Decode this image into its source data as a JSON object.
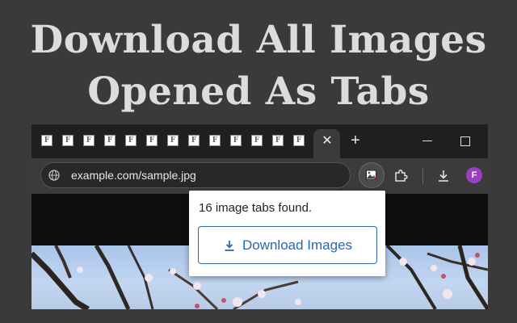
{
  "headline": {
    "line1": "Download All Images",
    "line2": "Opened As Tabs"
  },
  "browser": {
    "tab_favicon_letter": "F",
    "tab_count_visible": 13,
    "address": "example.com/sample.jpg",
    "avatar_letter": "F",
    "icons": [
      "globe-icon",
      "extension-image-icon",
      "puzzle-icon",
      "download-icon",
      "close-icon",
      "plus-icon",
      "minimize-icon",
      "maximize-icon"
    ]
  },
  "popup": {
    "status_text": "16 image tabs found.",
    "button_label": "Download Images"
  },
  "colors": {
    "accent": "#2f66a8",
    "avatar": "#9b3fc5",
    "background": "#3a3a3a",
    "headline": "#dcdcdc"
  }
}
